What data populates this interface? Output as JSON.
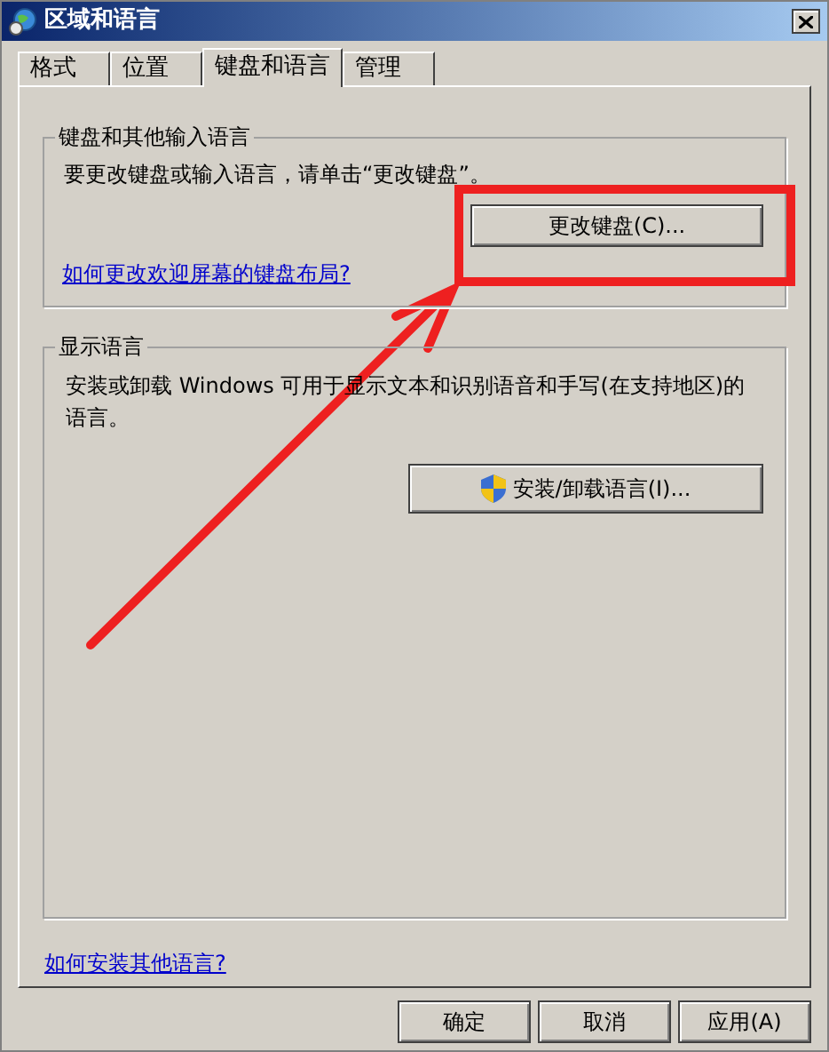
{
  "window": {
    "title": "区域和语言"
  },
  "tabs": [
    {
      "label": "格式",
      "selected": false
    },
    {
      "label": "位置",
      "selected": false
    },
    {
      "label": "键盘和语言",
      "selected": true
    },
    {
      "label": "管理",
      "selected": false
    }
  ],
  "keyboard_group": {
    "title": "键盘和其他输入语言",
    "text": "要更改键盘或输入语言，请单击“更改键盘”。",
    "button": "更改键盘(C)...",
    "link": "如何更改欢迎屏幕的键盘布局?"
  },
  "display_group": {
    "title": "显示语言",
    "text": "安装或卸载 Windows 可用于显示文本和识别语音和手写(在支持地区)的语言。",
    "button": "安装/卸载语言(I)..."
  },
  "link": "如何安装其他语言?",
  "buttons": [
    "确定",
    "取消",
    "应用(A)"
  ]
}
